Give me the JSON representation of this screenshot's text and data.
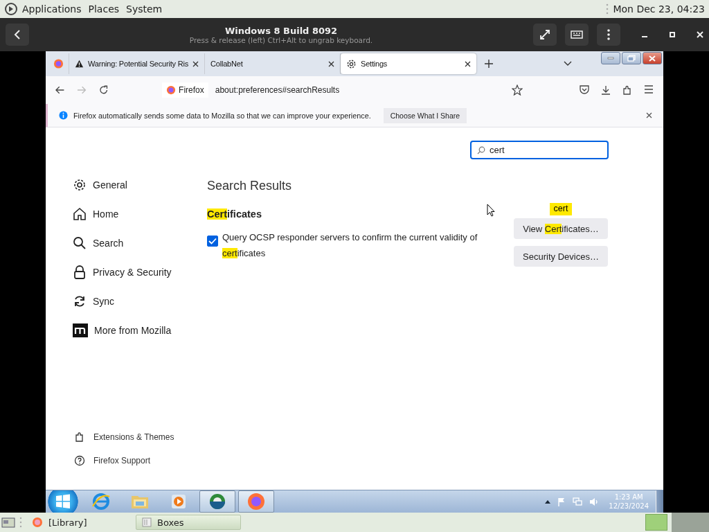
{
  "top_bar": {
    "menus": [
      "Applications",
      "Places",
      "System"
    ],
    "clock": "Mon Dec 23, 04:23"
  },
  "boxes_header": {
    "title": "Windows 8 Build 8092",
    "subtitle": "Press & release (left) Ctrl+Alt to ungrab keyboard."
  },
  "browser": {
    "tabs": [
      {
        "kind": "pinned",
        "selected": false
      },
      {
        "kind": "warning",
        "label": "Warning: Potential Security Ris",
        "selected": false
      },
      {
        "kind": "plain",
        "label": "CollabNet",
        "selected": false
      },
      {
        "kind": "settings",
        "label": "Settings",
        "selected": true
      }
    ],
    "identity": "Firefox",
    "url": "about:preferences#searchResults",
    "notification": {
      "text": "Firefox automatically sends some data to Mozilla so that we can improve your experience.",
      "button": "Choose What I Share"
    },
    "search": {
      "value": "cert"
    },
    "sidebar": [
      {
        "kind": "gear",
        "label": "General"
      },
      {
        "kind": "home",
        "label": "Home"
      },
      {
        "kind": "search",
        "label": "Search"
      },
      {
        "kind": "lock",
        "label": "Privacy & Security"
      },
      {
        "kind": "sync",
        "label": "Sync"
      },
      {
        "kind": "mozilla",
        "label": "More from Mozilla"
      }
    ],
    "sidebar_footer": [
      {
        "kind": "puzzle",
        "label": "Extensions & Themes"
      },
      {
        "kind": "help",
        "label": "Firefox Support"
      }
    ],
    "heading": "Search Results",
    "section_title": [
      {
        "text": "Cert",
        "highlighted": true
      },
      {
        "text": "ificates",
        "highlighted": false
      }
    ],
    "option": {
      "checked": true,
      "segments": [
        {
          "text": "Query OCSP responder servers to confirm the current validity of ",
          "highlighted": false
        },
        {
          "text": "cert",
          "highlighted": true
        },
        {
          "text": "ificates",
          "highlighted": false
        }
      ]
    },
    "search_tooltip": "cert",
    "buttons": [
      {
        "segments": [
          {
            "text": "View ",
            "highlighted": false
          },
          {
            "text": "Cert",
            "highlighted": true
          },
          {
            "text": "ificates…",
            "highlighted": false
          }
        ]
      },
      {
        "segments": [
          {
            "text": "Security Devices…",
            "highlighted": false
          }
        ]
      }
    ]
  },
  "win_taskbar": {
    "apps": [
      {
        "kind": "ie",
        "selected": false
      },
      {
        "kind": "folder",
        "selected": false
      },
      {
        "kind": "media",
        "selected": false
      },
      {
        "kind": "globe",
        "selected": true
      },
      {
        "kind": "firefox",
        "selected": true
      }
    ],
    "time": "1:23 AM",
    "date": "12/23/2024"
  },
  "bottom_bar": {
    "items": [
      {
        "label": "[Library]",
        "selected": false
      },
      {
        "label": "Boxes",
        "selected": true
      }
    ]
  }
}
